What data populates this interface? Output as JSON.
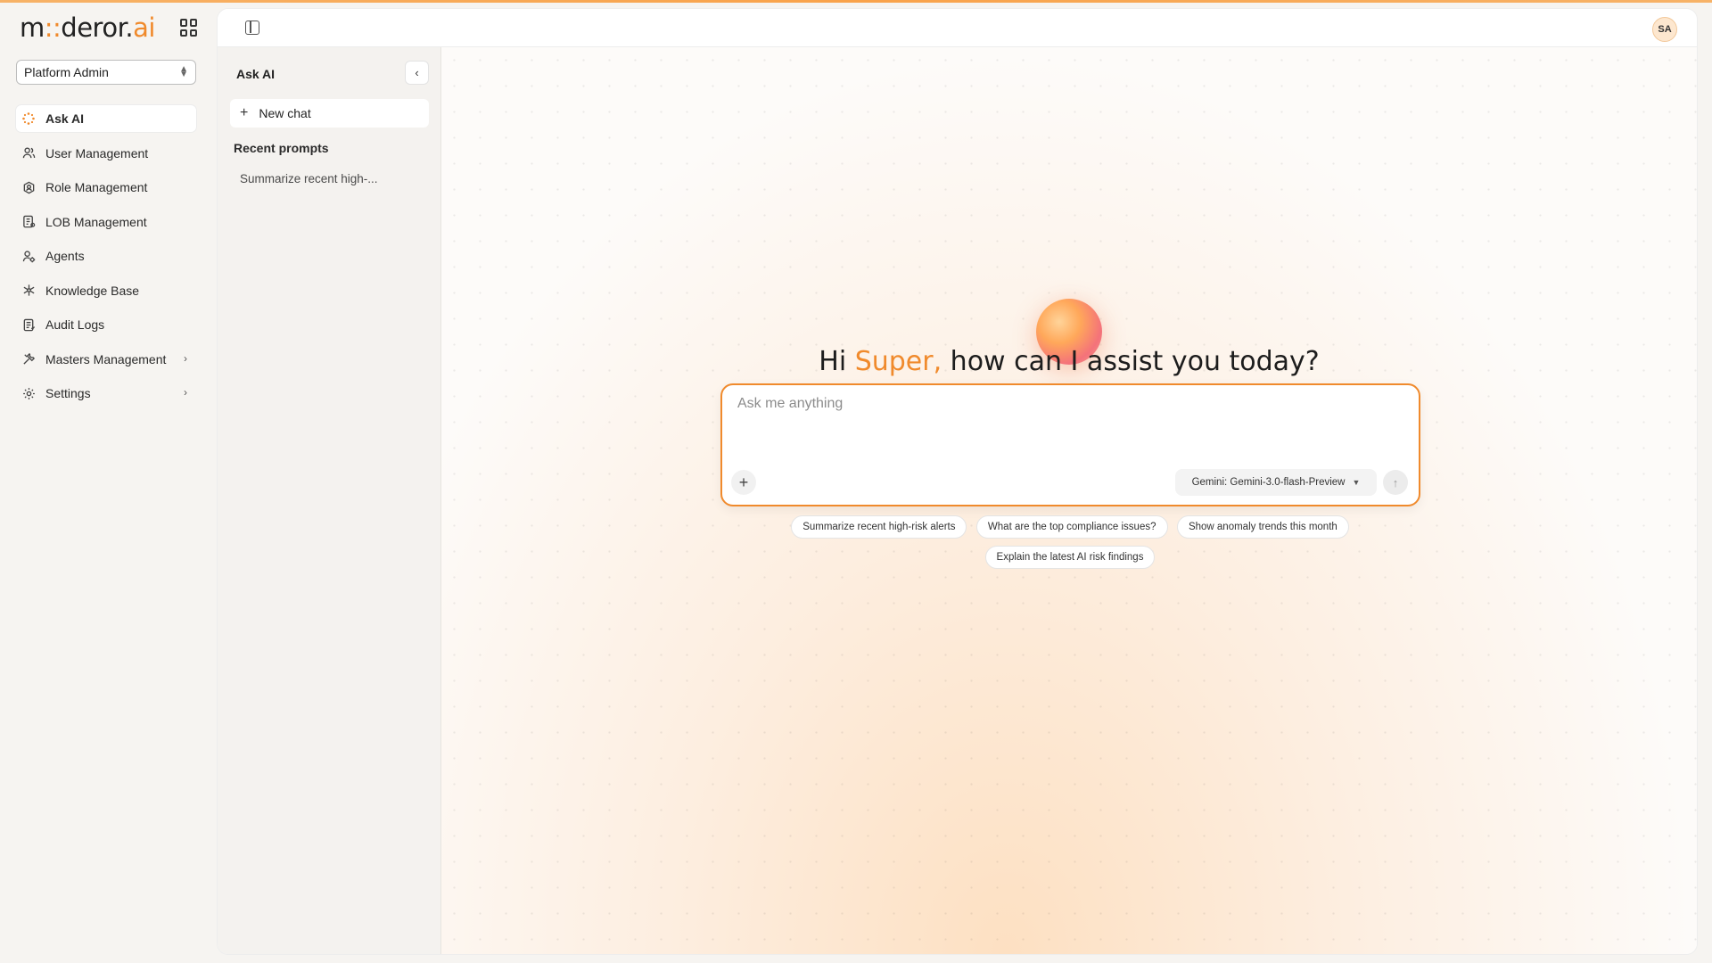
{
  "brand": {
    "logo_m": "m",
    "logo_dot": "::",
    "logo_deror": "deror",
    "logo_ai": "ai"
  },
  "org": {
    "selected": "Platform Admin"
  },
  "nav": {
    "items": [
      {
        "label": "Ask AI",
        "icon": "sparkle-icon",
        "active": true
      },
      {
        "label": "User Management",
        "icon": "users-icon"
      },
      {
        "label": "Role Management",
        "icon": "role-gear-icon"
      },
      {
        "label": "LOB Management",
        "icon": "lob-icon"
      },
      {
        "label": "Agents",
        "icon": "agent-icon"
      },
      {
        "label": "Knowledge Base",
        "icon": "network-icon"
      },
      {
        "label": "Audit Logs",
        "icon": "clipboard-icon"
      },
      {
        "label": "Masters Management",
        "icon": "tools-icon",
        "expandable": true
      },
      {
        "label": "Settings",
        "icon": "gear-icon",
        "expandable": true
      }
    ]
  },
  "header": {
    "avatar_initials": "SA"
  },
  "chat_panel": {
    "title": "Ask AI",
    "new_chat_label": "New chat",
    "recent_title": "Recent prompts",
    "recent_items": [
      "Summarize recent high-..."
    ]
  },
  "hero": {
    "greeting_prefix": "Hi ",
    "user_name": "Super,",
    "greeting_suffix": " how can I assist you today?"
  },
  "composer": {
    "placeholder": "Ask me anything",
    "value": "",
    "model": "Gemini: Gemini-3.0-flash-Preview"
  },
  "suggestions": [
    "Summarize recent high-risk alerts",
    "What are the top compliance issues?",
    "Show anomaly trends this month",
    "Explain the latest AI risk findings"
  ],
  "colors": {
    "accent": "#f08a2c",
    "avatar_bg": "#fde7cf"
  }
}
